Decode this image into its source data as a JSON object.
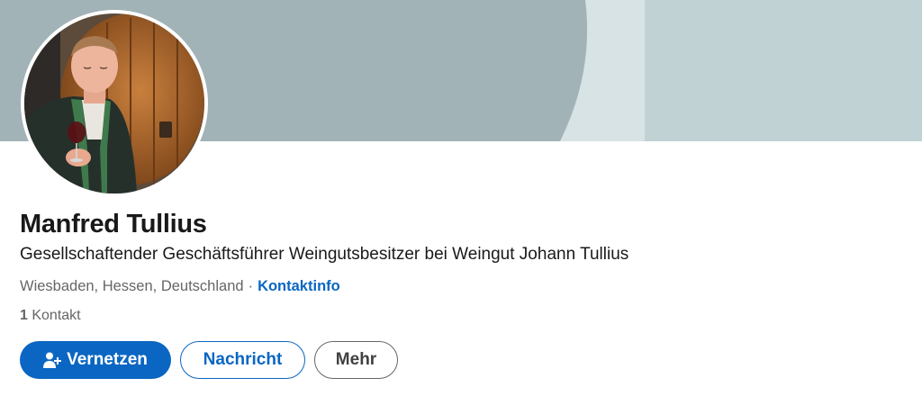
{
  "profile": {
    "name": "Manfred Tullius",
    "headline": "Gesellschaftender Geschäftsführer Weingutsbesitzer bei Weingut Johann Tullius",
    "location": "Wiesbaden, Hessen, Deutschland",
    "separator": "·",
    "contact_info_label": "Kontaktinfo",
    "connections_count": "1",
    "connections_label": "Kontakt"
  },
  "actions": {
    "connect_label": "Vernetzen",
    "message_label": "Nachricht",
    "more_label": "Mehr"
  },
  "colors": {
    "accent": "#0a66c2",
    "banner": "#a2b3b7",
    "banner_light": "#c1d2d5"
  },
  "icons": {
    "connect": "person-add-icon",
    "avatar": "profile-photo"
  }
}
